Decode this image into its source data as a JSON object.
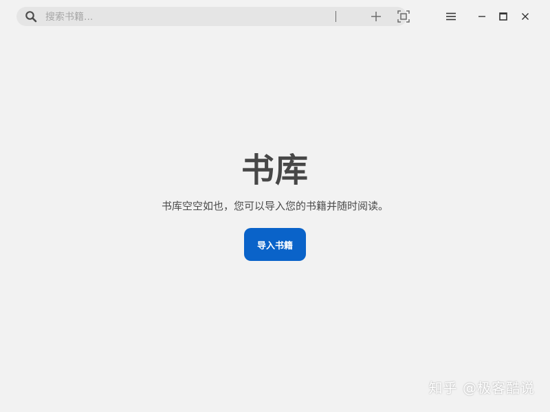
{
  "search": {
    "placeholder": "搜索书籍...",
    "value": "",
    "icon": "search-icon"
  },
  "toolbar": {
    "add_icon": "plus-icon",
    "fullscreen_icon": "fullscreen-icon"
  },
  "window_controls": {
    "menu_icon": "hamburger-menu-icon",
    "minimize_icon": "minimize-icon",
    "maximize_icon": "maximize-icon",
    "close_icon": "close-icon"
  },
  "library": {
    "title": "书库",
    "empty_message": "书库空空如也，您可以导入您的书籍并随时阅读。",
    "import_label": "导入书籍"
  },
  "watermark": {
    "text": "知乎 @极客酷说"
  },
  "colors": {
    "background": "#f2f2f2",
    "search_bg": "#e5e5e5",
    "accent": "#0a63c9",
    "title_text": "#474747"
  }
}
